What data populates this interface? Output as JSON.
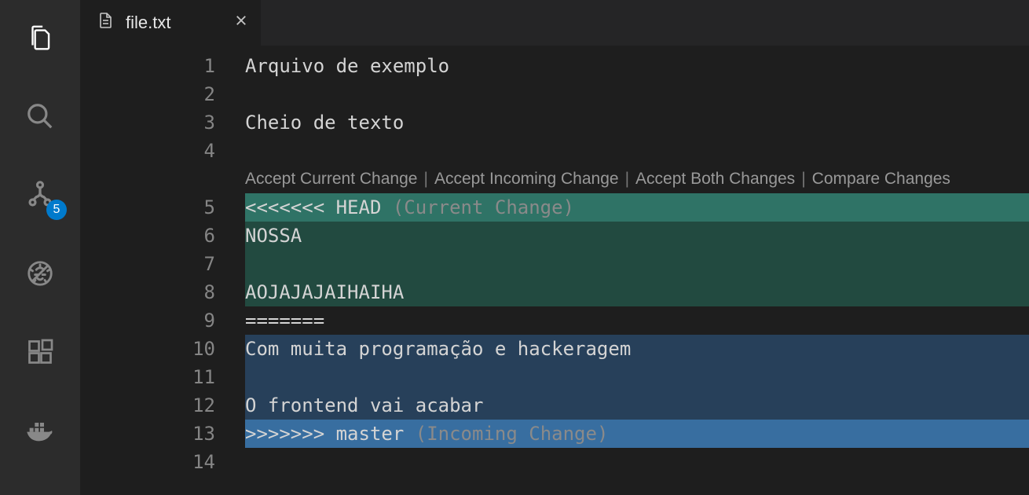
{
  "activityBar": {
    "badgeCount": "5"
  },
  "tab": {
    "filename": "file.txt"
  },
  "codelens": {
    "acceptCurrent": "Accept Current Change",
    "acceptIncoming": "Accept Incoming Change",
    "acceptBoth": "Accept Both Changes",
    "compare": "Compare Changes"
  },
  "lines": {
    "n1": "1",
    "l1": "Arquivo de exemplo",
    "n2": "2",
    "l2": "",
    "n3": "3",
    "l3": "Cheio de texto",
    "n4": "4",
    "l4": "",
    "n5": "5",
    "l5a": "<<<<<<< HEAD ",
    "l5b": "(Current Change)",
    "n6": "6",
    "l6": "NOSSA",
    "n7": "7",
    "l7": "",
    "n8": "8",
    "l8": "AOJAJAJAIHAIHA",
    "n9": "9",
    "l9": "=======",
    "n10": "10",
    "l10": "Com muita programação e hackeragem",
    "n11": "11",
    "l11": "",
    "n12": "12",
    "l12": "O frontend vai acabar",
    "n13": "13",
    "l13a": ">>>>>>> master ",
    "l13b": "(Incoming Change)",
    "n14": "14",
    "l14": ""
  }
}
